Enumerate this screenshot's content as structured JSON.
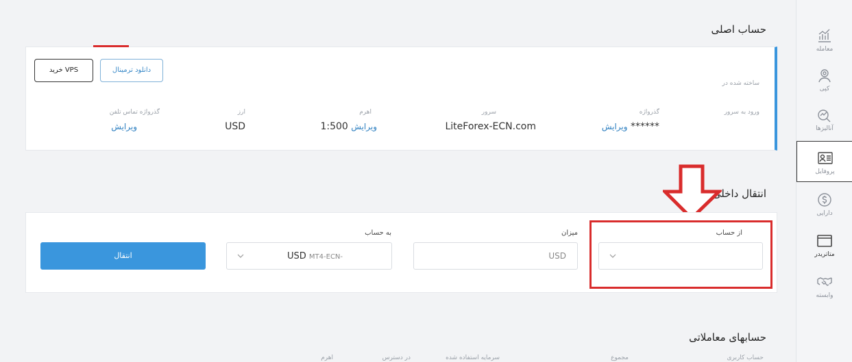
{
  "sidebar": {
    "items": [
      {
        "label": "معامله",
        "icon": "chart-icon"
      },
      {
        "label": "کپی",
        "icon": "user-copy-icon"
      },
      {
        "label": "آنالیزها",
        "icon": "analysis-icon"
      },
      {
        "label": "پروفایل",
        "icon": "profile-card-icon"
      },
      {
        "label": "دارایی",
        "icon": "dollar-icon"
      },
      {
        "label": "متاتریدر",
        "icon": "window-icon"
      },
      {
        "label": "وابسته",
        "icon": "handshake-icon"
      }
    ],
    "active_index": 3
  },
  "main_account": {
    "title": "حساب اصلی",
    "created_label": "ساخته شده در",
    "login_label": "ورود به سرور",
    "buttons": {
      "download_terminal": "دانلود ترمینال",
      "buy_vps": "خرید VPS"
    },
    "fields": {
      "password_label": "گذرواژه",
      "password_value": "******",
      "server_label": "سرور",
      "server_value": "LiteForex-ECN.com",
      "leverage_label": "اهرم",
      "leverage_value": "1:500",
      "currency_label": "ارز",
      "currency_value": "USD",
      "phone_password_label": "گذرواژه تماس تلفن",
      "edit_label": "ویرایش"
    }
  },
  "transfer": {
    "title": "انتقال داخلی",
    "from_label": "از حساب",
    "amount_label": "میزان",
    "amount_placeholder": "USD",
    "to_label": "به حساب",
    "to_value_prefix": "MT4-ECN-",
    "to_value_currency": "USD",
    "submit_label": "انتقال"
  },
  "trading_accounts": {
    "title": "حسابهای معاملاتی",
    "columns": [
      "حساب کاربری",
      "مجموع",
      "سرمایه استفاده شده",
      "در دسترس",
      "اهرم"
    ]
  },
  "colors": {
    "accent": "#3a96dd",
    "highlight": "#d92c2c",
    "link": "#2d7fc0"
  }
}
